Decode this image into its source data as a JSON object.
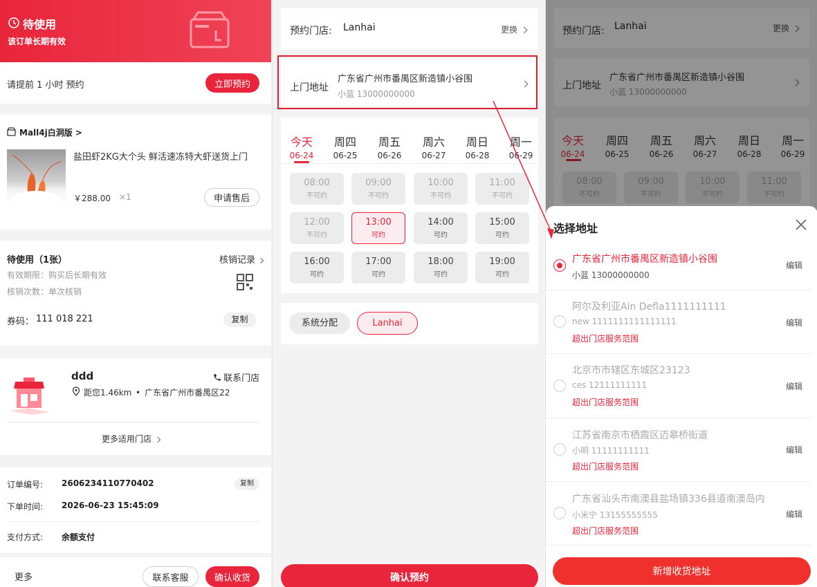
{
  "left": {
    "header": {
      "status": "待使用",
      "sub": "该订单长期有效"
    },
    "reserve": {
      "hint": "请提前 1 小时 预约",
      "button": "立即预约"
    },
    "shop": {
      "name": "Mall4j白洞版",
      "arrow": ">"
    },
    "product": {
      "title": "盐田虾2KG大个头 鲜活速冻特大虾送货上门",
      "price": "￥288.00",
      "qty": "×1",
      "after_sale": "申请售后"
    },
    "voucher": {
      "title": "待使用（1张）",
      "record": "核销记录",
      "validity": "有效期限：购买后长期有效",
      "times": "核销次数：单次核销",
      "code_label": "券码：",
      "code": "111 018 221",
      "copy": "复制"
    },
    "store": {
      "name": "ddd",
      "contact": "联系门店",
      "distance": "距您1.46km",
      "address": "广东省广州市番禺区22",
      "more": "更多适用门店",
      "dot": "•"
    },
    "order": {
      "no_label": "订单编号:",
      "no": "2606234110770402",
      "copy": "复制",
      "time_label": "下单时间:",
      "time": "2026-06-23 15:45:09",
      "pay_label": "支付方式:",
      "pay": "余额支付"
    },
    "footer": {
      "more": "更多",
      "service": "联系客服",
      "confirm": "确认收货"
    }
  },
  "middle": {
    "store_label": "预约门店:",
    "store_name": "Lanhai",
    "change": "更换",
    "addr_label": "上门地址",
    "addr": "广东省广州市番禺区新造镇小谷围",
    "contact": "小蓝 13000000000",
    "days": [
      {
        "d": "今天",
        "date": "06-24"
      },
      {
        "d": "周四",
        "date": "06-25"
      },
      {
        "d": "周五",
        "date": "06-26"
      },
      {
        "d": "周六",
        "date": "06-27"
      },
      {
        "d": "周日",
        "date": "06-28"
      },
      {
        "d": "周一",
        "date": "06-29"
      }
    ],
    "slots": [
      {
        "t": "08:00",
        "s": "不可约"
      },
      {
        "t": "09:00",
        "s": "不可约"
      },
      {
        "t": "10:00",
        "s": "不可约"
      },
      {
        "t": "11:00",
        "s": "不可约"
      },
      {
        "t": "12:00",
        "s": "不可约"
      },
      {
        "t": "13:00",
        "s": "可约"
      },
      {
        "t": "14:00",
        "s": "可约"
      },
      {
        "t": "15:00",
        "s": "可约"
      },
      {
        "t": "16:00",
        "s": "可约"
      },
      {
        "t": "17:00",
        "s": "可约"
      },
      {
        "t": "18:00",
        "s": "可约"
      },
      {
        "t": "19:00",
        "s": "可约"
      }
    ],
    "assign": {
      "system": "系统分配",
      "staff": "Lanhai"
    },
    "confirm": "确认预约"
  },
  "right": {
    "title": "选择地址",
    "addresses": [
      {
        "addr": "广东省广州市番禺区新造镇小谷围",
        "contact": "小蓝 13000000000",
        "edit": "编辑",
        "warn": ""
      },
      {
        "addr": "阿尔及利亚Ain Defla1111111111",
        "contact": "new 1111111111111111",
        "edit": "编辑",
        "warn": "超出门店服务范围"
      },
      {
        "addr": "北京市市辖区东城区23123",
        "contact": "ces 12111111111",
        "edit": "编辑",
        "warn": "超出门店服务范围"
      },
      {
        "addr": "江苏省南京市栖霞区迈皋桥街道",
        "contact": "小明 11111111111",
        "edit": "编辑",
        "warn": "超出门店服务范围"
      },
      {
        "addr": "广东省汕头市南澳县盐场镇336县道南澳岛内",
        "contact": "小米宁 13155555555",
        "edit": "编辑",
        "warn": "超出门店服务范围"
      }
    ],
    "add_button": "新增收货地址"
  }
}
